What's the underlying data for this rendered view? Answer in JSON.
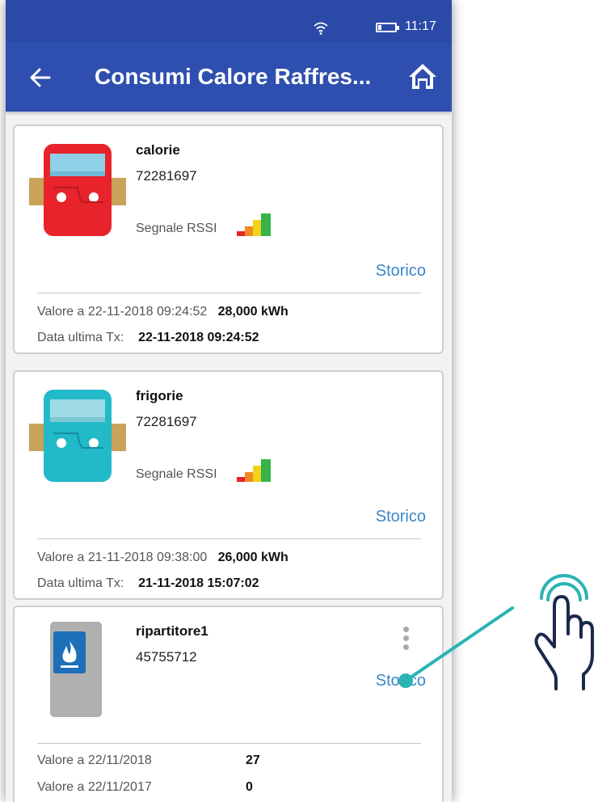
{
  "status_bar": {
    "time": "11:17",
    "wifi_icon": "wifi-icon",
    "battery_icon": "battery-icon"
  },
  "app_bar": {
    "title": "Consumi Calore Raffres...",
    "back_icon": "arrow-left-icon",
    "home_icon": "home-icon",
    "color": "#2e4faf"
  },
  "devices": [
    {
      "name": "calorie",
      "serial": "72281697",
      "rssi_label": "Segnale RSSI",
      "storico_label": "Storico",
      "meter_color": "#e8232b",
      "value_label": "Valore a 22-11-2018 09:24:52",
      "value": "28,000 kWh",
      "last_tx_label": "Data ultima Tx:",
      "last_tx": "22-11-2018 09:24:52"
    },
    {
      "name": "frigorie",
      "serial": "72281697",
      "rssi_label": "Segnale RSSI",
      "storico_label": "Storico",
      "meter_color": "#22b9c9",
      "value_label": "Valore a 21-11-2018 09:38:00",
      "value": "26,000 kWh",
      "last_tx_label": "Data ultima Tx:",
      "last_tx": "21-11-2018 15:07:02"
    },
    {
      "name": "ripartitore1",
      "serial": "45755712",
      "storico_label": "Storico",
      "rows": [
        {
          "label": "Valore a 22/11/2018",
          "value": "27"
        },
        {
          "label": "Valore a 22/11/2017",
          "value": "0"
        }
      ]
    }
  ],
  "accent_colors": {
    "link": "#3a86c8",
    "callout": "#2bb3b3",
    "hand": "#1b2a4a"
  }
}
